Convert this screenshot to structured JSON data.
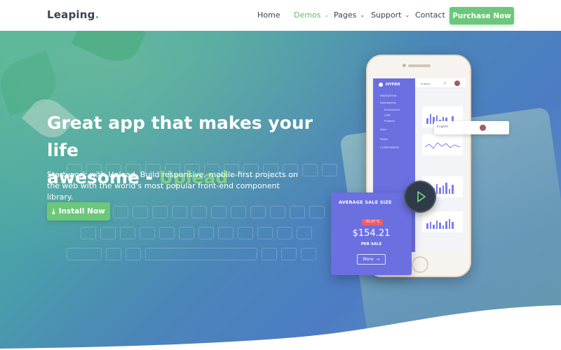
{
  "header": {
    "logo": "Leaping",
    "logo_dot": ".",
    "nav": [
      {
        "label": "Home",
        "has_dropdown": false,
        "active": false
      },
      {
        "label": "Demos",
        "has_dropdown": true,
        "active": true
      },
      {
        "label": "Pages",
        "has_dropdown": true,
        "active": false
      },
      {
        "label": "Support",
        "has_dropdown": true,
        "active": false
      },
      {
        "label": "Contact",
        "has_dropdown": false,
        "active": false
      }
    ],
    "purchase_label": "Purchase Now"
  },
  "hero": {
    "title_line1": "Great app that makes your life",
    "title_line2": "awesome - ",
    "title_accent": "Uplead",
    "subtitle": "Start work with Uplead. Build responsive, mobile-first projects on the web with the world's most popular front-end component library.",
    "install_label": "Install Now"
  },
  "mockup": {
    "brand": "HYPER",
    "sidebar_items": [
      "NAVIGATION",
      "Dashboards",
      "Ecommerce",
      "CRM",
      "Projects",
      "Apps",
      "Pages",
      "COMPONENTS"
    ],
    "language": "English",
    "sale_card": {
      "label": "AVERAGE SALE SIZE",
      "badge": "-33.47 %",
      "amount": "$154.21",
      "caption": "PER SALE",
      "more_label": "More"
    }
  },
  "colors": {
    "accent_green": "#6cc77b",
    "card_purple": "#6c6fe0",
    "text_dark": "#3b4250"
  },
  "icons": {
    "nav_dropdown": "chevron-down-icon",
    "install": "download-icon",
    "video": "play-icon"
  }
}
